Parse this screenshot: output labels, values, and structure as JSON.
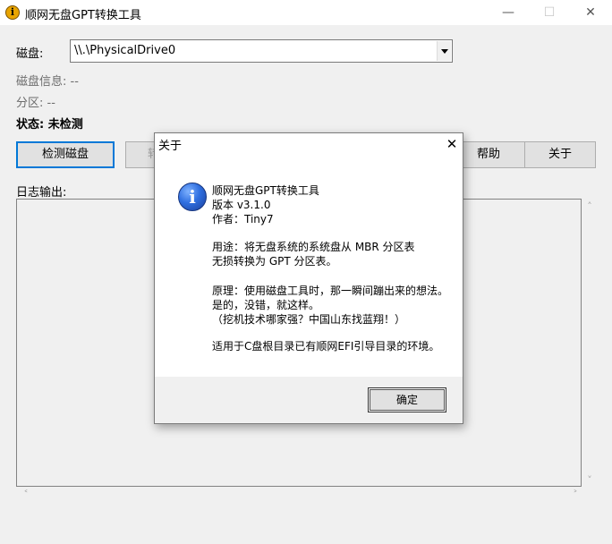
{
  "window": {
    "title": "顺网无盘GPT转换工具",
    "icon_glyph": "i",
    "minimize": "—",
    "maximize": "☐",
    "close": "✕"
  },
  "form": {
    "disk_label": "磁盘:",
    "disk_value": "\\\\.\\PhysicalDrive0",
    "disk_info": "磁盘信息: --",
    "partition": "分区: --",
    "status": "状态: 未检测"
  },
  "toolbar": {
    "detect": "检测磁盘",
    "convert_partial": "转",
    "help": "帮助",
    "about": "关于"
  },
  "log": {
    "label": "日志输出:"
  },
  "scroll": {
    "up": "˄",
    "down": "˅",
    "left": "˂",
    "right": "˃"
  },
  "dialog": {
    "title": "关于",
    "close": "✕",
    "icon_glyph": "i",
    "lines": [
      "顺网无盘GPT转换工具",
      "版本 v3.1.0",
      "作者：Tiny7",
      "用途：将无盘系统的系统盘从 MBR 分区表",
      "无损转换为 GPT 分区表。",
      "原理：使用磁盘工具时，那一瞬间蹦出来的想法。",
      "是的，没错，就这样。",
      "（挖机技术哪家强？中国山东找蓝翔！）",
      "适用于C盘根目录已有顺网EFI引导目录的环境。"
    ],
    "ok": "确定"
  }
}
